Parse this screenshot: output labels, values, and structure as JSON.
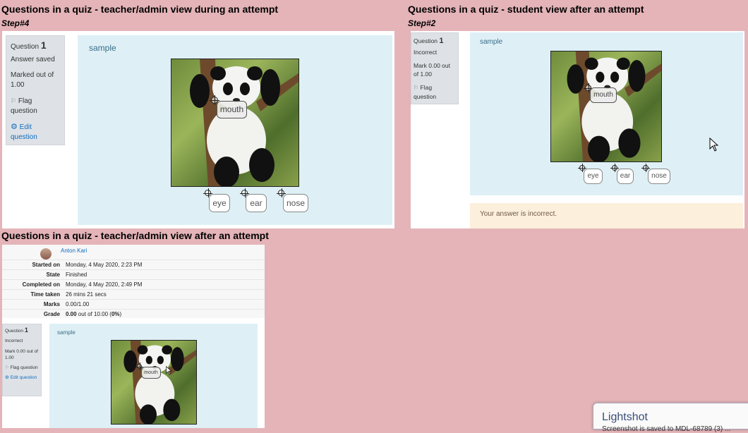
{
  "sections": {
    "teacher_during": {
      "heading": "Questions in a quiz - teacher/admin view during an attempt",
      "step": "Step#4",
      "info": {
        "question_label": "Question",
        "question_number": "1",
        "state": "Answer saved",
        "marked": "Marked out of 1.00",
        "flag": "Flag question",
        "edit": "Edit question"
      },
      "question_text": "sample",
      "drop_label": "mouth",
      "drag_items": [
        "eye",
        "ear",
        "nose"
      ]
    },
    "student_after": {
      "heading": "Questions in a quiz - student view after an attempt",
      "step": "Step#2",
      "info": {
        "question_label": "Question",
        "question_number": "1",
        "state": "Incorrect",
        "marked": "Mark 0.00 out of 1.00",
        "flag": "Flag question"
      },
      "question_text": "sample",
      "drop_label": "mouth",
      "drag_items": [
        "eye",
        "ear",
        "nose"
      ],
      "feedback": "Your answer is incorrect."
    },
    "teacher_after": {
      "heading": "Questions in a quiz - teacher/admin view after an attempt",
      "user_name": "Anton Kari",
      "summary": [
        {
          "label": "Started on",
          "value": "Monday, 4 May 2020, 2:23 PM"
        },
        {
          "label": "State",
          "value": "Finished"
        },
        {
          "label": "Completed on",
          "value": "Monday, 4 May 2020, 2:49 PM"
        },
        {
          "label": "Time taken",
          "value": "26 mins 21 secs"
        },
        {
          "label": "Marks",
          "value": "0.00/1.00"
        }
      ],
      "grade_label": "Grade",
      "grade_value": "0.00",
      "grade_rest": " out of 10.00 (",
      "grade_percent": "0%",
      "grade_close": ")",
      "info": {
        "question_label": "Question",
        "question_number": "1",
        "state": "Incorrect",
        "marked": "Mark 0.00 out of 1.00",
        "flag": "Flag question",
        "edit": "Edit question"
      },
      "question_text": "sample",
      "drop_label": "mouth"
    }
  },
  "lightshot": {
    "title": "Lightshot",
    "subtitle": "Screenshot is saved to MDL-68789 (3) ..."
  },
  "icons": {
    "flag": "flag-icon",
    "edit": "gear-icon",
    "crosshair": "crosshair-icon",
    "cursor": "mouse-pointer-icon",
    "avatar": "user-avatar"
  },
  "colors": {
    "page_bg": "#e4b4b8",
    "question_bg": "#def0f6",
    "info_bg": "#dee2e6",
    "feedback_bg": "#fcefdc",
    "link": "#0f6cbf"
  }
}
